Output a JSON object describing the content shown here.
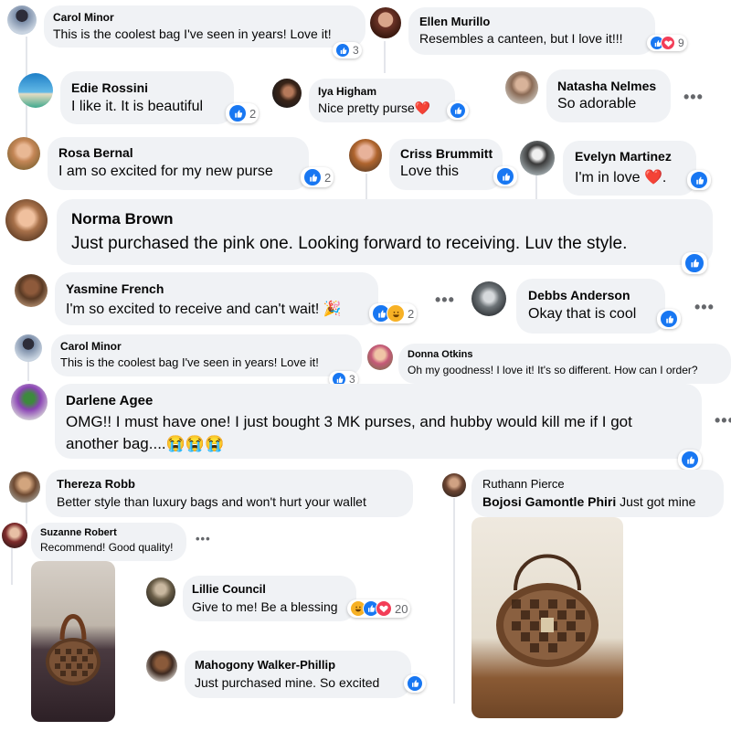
{
  "comments": [
    {
      "name": "Carol Minor",
      "text": "This is the coolest bag I've seen in years! Love it!",
      "reactions": [
        {
          "icon": "like-icon"
        }
      ],
      "count": "3"
    },
    {
      "name": "Ellen Murillo",
      "text": "Resembles a canteen, but I love it!!!",
      "reactions": [
        {
          "icon": "like-icon"
        },
        {
          "icon": "love-icon"
        }
      ],
      "count": "9"
    },
    {
      "name": "Edie Rossini",
      "text": "I like it. It is beautiful",
      "reactions": [
        {
          "icon": "like-icon"
        }
      ],
      "count": "2"
    },
    {
      "name": "Iya Higham",
      "text": "Nice pretty purse❤️",
      "reactions": [
        {
          "icon": "like-icon"
        }
      ],
      "count": ""
    },
    {
      "name": "Natasha Nelmes",
      "text": "So adorable",
      "reactions": [],
      "count": ""
    },
    {
      "name": "Rosa Bernal",
      "text": "I am so excited for my new purse",
      "reactions": [
        {
          "icon": "like-icon"
        }
      ],
      "count": "2"
    },
    {
      "name": "Criss Brummitt",
      "text": "Love this",
      "reactions": [
        {
          "icon": "like-icon"
        }
      ],
      "count": ""
    },
    {
      "name": "Evelyn Martinez",
      "text": "I'm in love ❤️.",
      "reactions": [
        {
          "icon": "like-icon"
        }
      ],
      "count": ""
    },
    {
      "name": "Norma Brown",
      "text": "Just purchased the pink one. Looking forward to receiving. Luv the style.",
      "reactions": [
        {
          "icon": "like-icon"
        }
      ],
      "count": ""
    },
    {
      "name": "Yasmine French",
      "text": "I'm so excited to receive and can't wait! 🎉",
      "reactions": [
        {
          "icon": "like-icon"
        },
        {
          "icon": "haha-icon"
        }
      ],
      "count": "2"
    },
    {
      "name": "Debbs Anderson",
      "text": "Okay that is cool",
      "reactions": [
        {
          "icon": "like-icon"
        }
      ],
      "count": ""
    },
    {
      "name": "Carol Minor",
      "text": "This is the coolest bag I've seen in years! Love it!",
      "reactions": [
        {
          "icon": "like-icon"
        }
      ],
      "count": "3"
    },
    {
      "name": "Donna Otkins",
      "text": "Oh my goodness! I love it! It's so different. How can I order?",
      "reactions": [],
      "count": ""
    },
    {
      "name": "Darlene Agee",
      "text": "OMG!! I must have one! I just bought 3 MK purses, and hubby would kill me if I got",
      "text2": "another bag....😭😭😭",
      "reactions": [
        {
          "icon": "like-icon"
        }
      ],
      "count": ""
    },
    {
      "name": "Thereza Robb",
      "text": "Better style than luxury bags and won't hurt your wallet",
      "reactions": [],
      "count": ""
    },
    {
      "name": "Ruthann Pierce",
      "text": "Bojosi Gamontle Phiri",
      "text_rest": " Just got mine",
      "reactions": [],
      "count": ""
    },
    {
      "name": "Suzanne Robert",
      "text": "Recommend! Good quality!",
      "reactions": [],
      "count": ""
    },
    {
      "name": "Lillie Council",
      "text": "Give to me! Be a blessing",
      "reactions": [
        {
          "icon": "haha-icon"
        },
        {
          "icon": "like-icon"
        },
        {
          "icon": "love-icon"
        }
      ],
      "count": "20"
    },
    {
      "name": "Mahogony Walker-Phillip",
      "text": "Just purchased mine. So excited",
      "reactions": [
        {
          "icon": "like-icon"
        }
      ],
      "count": ""
    }
  ],
  "dots": "•••",
  "colors": {
    "like": "#1877f2",
    "love": "#f33e58",
    "haha": "#f7b125",
    "bubble": "#f0f2f5"
  }
}
